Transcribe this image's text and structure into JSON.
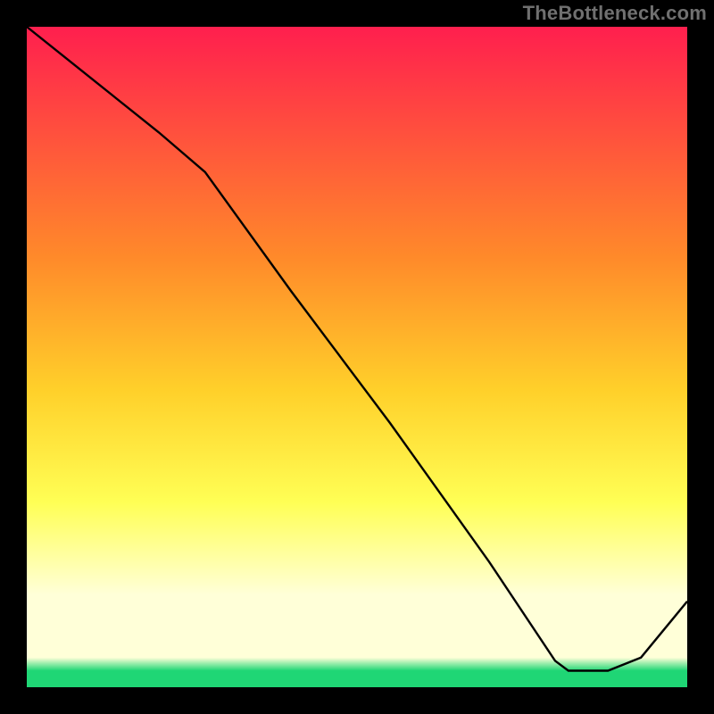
{
  "watermark": "TheBottleneck.com",
  "annotation_text": "",
  "colors": {
    "top": "#ff1f4e",
    "mid1": "#ff8a2a",
    "mid2": "#ffd02a",
    "mid3": "#ffff55",
    "pale": "#ffffd8",
    "green": "#1fd675",
    "border": "#000000",
    "line": "#000000"
  },
  "chart_data": {
    "type": "line",
    "title": "",
    "xlabel": "",
    "ylabel": "",
    "xlim": [
      0,
      100
    ],
    "ylim": [
      0,
      100
    ],
    "grid": false,
    "legend": false,
    "series": [
      {
        "name": "bottleneck-curve",
        "x": [
          0,
          10,
          20,
          27,
          40,
          55,
          70,
          80,
          82,
          86,
          88,
          93,
          100
        ],
        "y": [
          100,
          92,
          84,
          78,
          60,
          40,
          19,
          4,
          2.5,
          2.5,
          2.5,
          4.5,
          13
        ]
      }
    ],
    "annotations": [
      {
        "x": 86,
        "y": 3.0,
        "text": ""
      }
    ],
    "background_gradient_stops": [
      {
        "pct": 0.0,
        "color": "#ff1f4e"
      },
      {
        "pct": 0.35,
        "color": "#ff8a2a"
      },
      {
        "pct": 0.55,
        "color": "#ffd02a"
      },
      {
        "pct": 0.72,
        "color": "#ffff55"
      },
      {
        "pct": 0.86,
        "color": "#ffffd8"
      },
      {
        "pct": 0.955,
        "color": "#ffffd8"
      },
      {
        "pct": 0.975,
        "color": "#1fd675"
      },
      {
        "pct": 1.0,
        "color": "#1fd675"
      }
    ]
  }
}
